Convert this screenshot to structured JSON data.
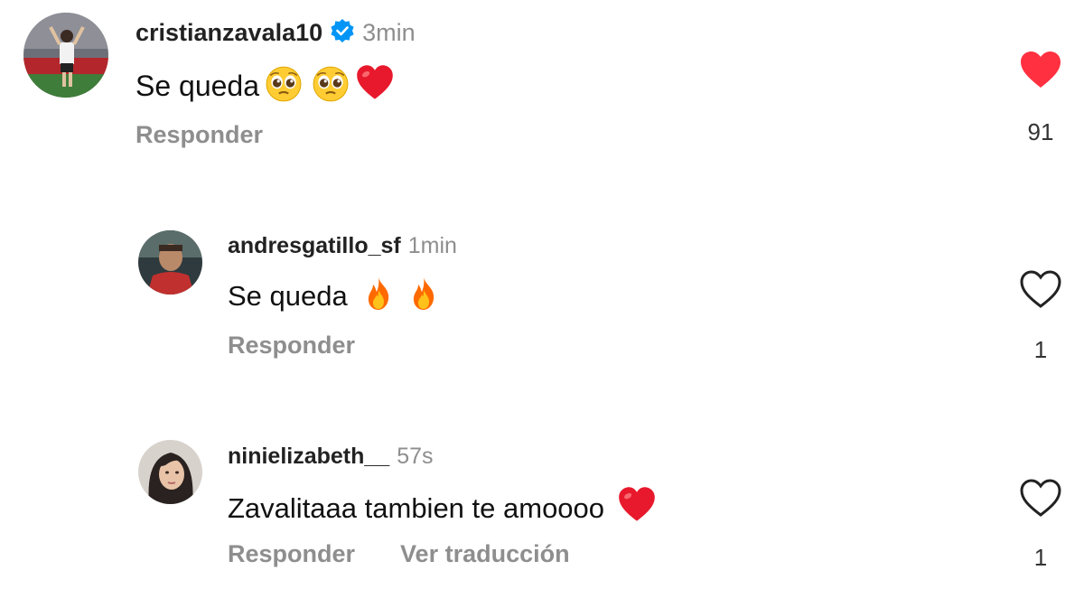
{
  "colors": {
    "like_red": "#ff3040",
    "verified_blue": "#0095f6",
    "muted": "#8e8e8e"
  },
  "comments": [
    {
      "username": "cristianzavala10",
      "verified": true,
      "time": "3min",
      "text": "Se queda",
      "emojis": [
        "pleading-face",
        "pleading-face",
        "red-heart"
      ],
      "reply_label": "Responder",
      "liked": true,
      "like_icon": "heart-filled-icon",
      "likes": "91"
    },
    {
      "username": "andresgatillo_sf",
      "verified": false,
      "time": "1min",
      "text": "Se queda",
      "emojis": [
        "fire",
        "fire"
      ],
      "reply_label": "Responder",
      "liked": false,
      "like_icon": "heart-outline-icon",
      "likes": "1"
    },
    {
      "username": "ninielizabeth__",
      "verified": false,
      "time": "57s",
      "text": "Zavalitaaa tambien te amoooo",
      "emojis": [
        "red-heart"
      ],
      "reply_label": "Responder",
      "translate_label": "Ver traducción",
      "liked": false,
      "like_icon": "heart-outline-icon",
      "likes": "1"
    }
  ]
}
